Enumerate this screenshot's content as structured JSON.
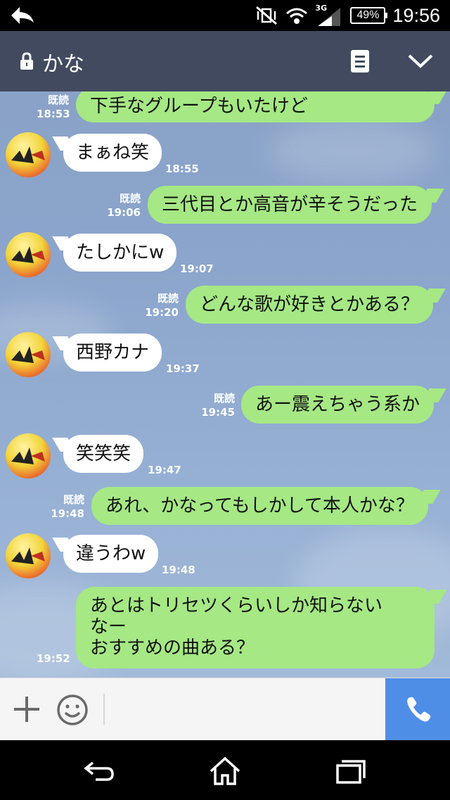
{
  "status_bar": {
    "network": "3G",
    "battery": "49%",
    "time": "19:56"
  },
  "header": {
    "title": "かな"
  },
  "messages": [
    {
      "side": "mine",
      "text": "下手なグループもいたけど",
      "read": "既読",
      "time": "18:53"
    },
    {
      "side": "other",
      "text": "まぁね笑",
      "time": "18:55"
    },
    {
      "side": "mine",
      "text": "三代目とか高音が辛そうだった",
      "read": "既読",
      "time": "19:06"
    },
    {
      "side": "other",
      "text": "たしかにw",
      "time": "19:07"
    },
    {
      "side": "mine",
      "text": "どんな歌が好きとかある？",
      "read": "既読",
      "time": "19:20"
    },
    {
      "side": "other",
      "text": "西野カナ",
      "time": "19:37"
    },
    {
      "side": "mine",
      "text": "あー震えちゃう系か",
      "read": "既読",
      "time": "19:45"
    },
    {
      "side": "other",
      "text": "笑笑笑",
      "time": "19:47"
    },
    {
      "side": "mine",
      "text": "あれ、かなってもしかして本人かな？",
      "read": "既読",
      "time": "19:48"
    },
    {
      "side": "other",
      "text": "違うわw",
      "time": "19:48"
    },
    {
      "side": "mine",
      "lines": [
        "あとはトリセツくらいしか知らない",
        "なー",
        "おすすめの曲ある？"
      ],
      "time": "19:52"
    }
  ],
  "input": {
    "placeholder": ""
  },
  "colors": {
    "header_bg": "#414a5e",
    "mine_bubble": "#a5e884",
    "other_bubble": "#ffffff",
    "call_button": "#4f8ee6"
  }
}
